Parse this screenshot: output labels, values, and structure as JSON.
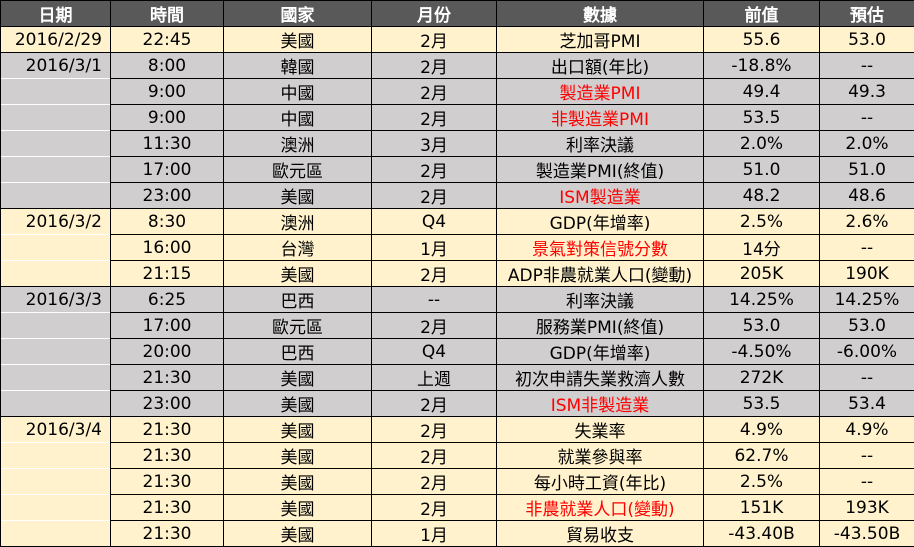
{
  "headers": [
    "日期",
    "時間",
    "國家",
    "月份",
    "數據",
    "前值",
    "預估"
  ],
  "rows": [
    {
      "date": "2016/2/29",
      "time": "22:45",
      "country": "美國",
      "month": "2月",
      "data": "芝加哥PMI",
      "prev": "55.6",
      "fore": "53.0",
      "red": false,
      "shade": "beige"
    },
    {
      "date": "2016/3/1",
      "time": "8:00",
      "country": "韓國",
      "month": "2月",
      "data": "出口額(年比)",
      "prev": "-18.8%",
      "fore": "--",
      "red": false,
      "shade": "gray"
    },
    {
      "date": "",
      "time": "9:00",
      "country": "中國",
      "month": "2月",
      "data": "製造業PMI",
      "prev": "49.4",
      "fore": "49.3",
      "red": true,
      "shade": "gray"
    },
    {
      "date": "",
      "time": "9:00",
      "country": "中國",
      "month": "2月",
      "data": "非製造業PMI",
      "prev": "53.5",
      "fore": "--",
      "red": true,
      "shade": "gray"
    },
    {
      "date": "",
      "time": "11:30",
      "country": "澳洲",
      "month": "3月",
      "data": "利率決議",
      "prev": "2.0%",
      "fore": "2.0%",
      "red": false,
      "shade": "gray"
    },
    {
      "date": "",
      "time": "17:00",
      "country": "歐元區",
      "month": "2月",
      "data": "製造業PMI(終值)",
      "prev": "51.0",
      "fore": "51.0",
      "red": false,
      "shade": "gray"
    },
    {
      "date": "",
      "time": "23:00",
      "country": "美國",
      "month": "2月",
      "data": "ISM製造業",
      "prev": "48.2",
      "fore": "48.6",
      "red": true,
      "shade": "gray"
    },
    {
      "date": "2016/3/2",
      "time": "8:30",
      "country": "澳洲",
      "month": "Q4",
      "data": "GDP(年增率)",
      "prev": "2.5%",
      "fore": "2.6%",
      "red": false,
      "shade": "beige"
    },
    {
      "date": "",
      "time": "16:00",
      "country": "台灣",
      "month": "1月",
      "data": "景氣對策信號分數",
      "prev": "14分",
      "fore": "--",
      "red": true,
      "shade": "beige"
    },
    {
      "date": "",
      "time": "21:15",
      "country": "美國",
      "month": "2月",
      "data": "ADP非農就業人口(變動)",
      "prev": "205K",
      "fore": "190K",
      "red": false,
      "shade": "beige"
    },
    {
      "date": "2016/3/3",
      "time": "6:25",
      "country": "巴西",
      "month": "--",
      "data": "利率決議",
      "prev": "14.25%",
      "fore": "14.25%",
      "red": false,
      "shade": "gray"
    },
    {
      "date": "",
      "time": "17:00",
      "country": "歐元區",
      "month": "2月",
      "data": "服務業PMI(終值)",
      "prev": "53.0",
      "fore": "53.0",
      "red": false,
      "shade": "gray"
    },
    {
      "date": "",
      "time": "20:00",
      "country": "巴西",
      "month": "Q4",
      "data": "GDP(年增率)",
      "prev": "-4.50%",
      "fore": "-6.00%",
      "red": false,
      "shade": "gray"
    },
    {
      "date": "",
      "time": "21:30",
      "country": "美國",
      "month": "上週",
      "data": "初次申請失業救濟人數",
      "prev": "272K",
      "fore": "--",
      "red": false,
      "shade": "gray"
    },
    {
      "date": "",
      "time": "23:00",
      "country": "美國",
      "month": "2月",
      "data": "ISM非製造業",
      "prev": "53.5",
      "fore": "53.4",
      "red": true,
      "shade": "gray"
    },
    {
      "date": "2016/3/4",
      "time": "21:30",
      "country": "美國",
      "month": "2月",
      "data": "失業率",
      "prev": "4.9%",
      "fore": "4.9%",
      "red": false,
      "shade": "beige"
    },
    {
      "date": "",
      "time": "21:30",
      "country": "美國",
      "month": "2月",
      "data": "就業參與率",
      "prev": "62.7%",
      "fore": "--",
      "red": false,
      "shade": "beige"
    },
    {
      "date": "",
      "time": "21:30",
      "country": "美國",
      "month": "2月",
      "data": "每小時工資(年比)",
      "prev": "2.5%",
      "fore": "--",
      "red": false,
      "shade": "beige"
    },
    {
      "date": "",
      "time": "21:30",
      "country": "美國",
      "month": "2月",
      "data": "非農就業人口(變動)",
      "prev": "151K",
      "fore": "193K",
      "red": true,
      "shade": "beige"
    },
    {
      "date": "",
      "time": "21:30",
      "country": "美國",
      "month": "1月",
      "data": "貿易收支",
      "prev": "-43.40B",
      "fore": "-43.50B",
      "red": false,
      "shade": "beige"
    }
  ],
  "colors": {
    "header_bg": "#595959",
    "beige": "#fff2cc",
    "gray": "#d0cece",
    "highlight_text": "#ff0000"
  }
}
